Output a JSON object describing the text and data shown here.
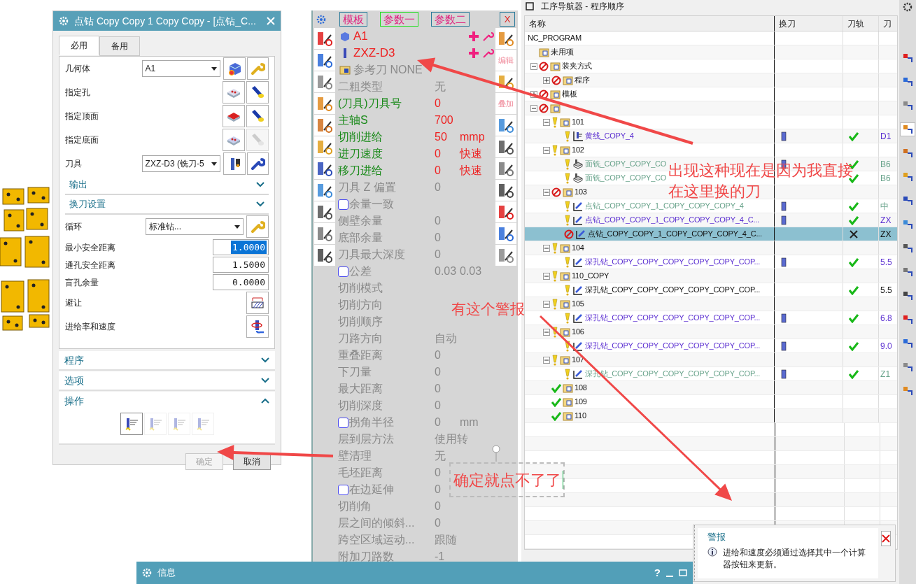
{
  "dialog": {
    "title": "点钻 Copy Copy 1 Copy Copy - [点钻_C...",
    "tabs": [
      {
        "label": "必用",
        "selected": true
      },
      {
        "label": "备用",
        "selected": false
      }
    ],
    "rows": [
      {
        "kind": "select",
        "label": "几何体",
        "value": "A1"
      },
      {
        "kind": "pick",
        "label": "指定孔",
        "disabled": false
      },
      {
        "kind": "pick",
        "label": "指定顶面",
        "disabled": false
      },
      {
        "kind": "pick",
        "label": "指定底面",
        "disabled": true
      },
      {
        "kind": "select",
        "label": "刀具",
        "value": "ZXZ-D3 (铣刀-5"
      },
      {
        "kind": "section",
        "label": "输出",
        "expanded": false
      },
      {
        "kind": "section",
        "label": "换刀设置",
        "expanded": false
      },
      {
        "kind": "select",
        "label": "循环",
        "value": "标准钻..."
      },
      {
        "kind": "number",
        "label": "最小安全距离",
        "value": "1.0000",
        "focused": true
      },
      {
        "kind": "number",
        "label": "通孔安全距离",
        "value": "1.5000",
        "focused": false
      },
      {
        "kind": "number",
        "label": "盲孔余量",
        "value": "0.0000",
        "focused": false
      },
      {
        "kind": "pick",
        "label": "避让"
      },
      {
        "kind": "pick",
        "label": "进给率和速度"
      }
    ],
    "groups": [
      {
        "label": "程序",
        "expanded": false
      },
      {
        "label": "选项",
        "expanded": false
      },
      {
        "label": "操作",
        "expanded": true
      }
    ],
    "actions": [
      {
        "disabled": false
      },
      {
        "disabled": true
      },
      {
        "disabled": true
      },
      {
        "disabled": true
      }
    ],
    "buttons": [
      {
        "label": "确定",
        "disabled": true
      },
      {
        "label": "取消",
        "disabled": false
      }
    ]
  },
  "param_panel": {
    "tabs": [
      {
        "label": "模板",
        "selected": false
      },
      {
        "label": "参数一",
        "selected": true
      },
      {
        "label": "参数二",
        "selected": false
      }
    ],
    "close": "X",
    "objects": [
      {
        "kind": "geometry",
        "label": "A1"
      },
      {
        "kind": "tool",
        "label": "ZXZ-D3"
      },
      {
        "kind": "reference",
        "label": "参考刀 NONE"
      }
    ],
    "right_tools": [
      {
        "kind": "icon"
      },
      {
        "kind": "text",
        "label": "编辑"
      },
      {
        "kind": "icon"
      },
      {
        "kind": "text",
        "label": "叠加"
      },
      {
        "kind": "icon"
      },
      {
        "kind": "icon"
      },
      {
        "kind": "icon"
      },
      {
        "kind": "icon"
      },
      {
        "kind": "icon"
      },
      {
        "kind": "icon"
      },
      {
        "kind": "icon"
      }
    ],
    "params": [
      {
        "kind": "field",
        "label": "二粗类型",
        "value": "无",
        "active": false
      },
      {
        "kind": "field",
        "label": "(刀具)刀具号",
        "value": "0",
        "active": true
      },
      {
        "kind": "field",
        "label": "主轴S",
        "value": "700",
        "active": true
      },
      {
        "kind": "field",
        "label": "切削进给",
        "value": "50",
        "unit": "mmp",
        "active": true
      },
      {
        "kind": "field",
        "label": "进刀速度",
        "value": "0",
        "unit": "快速",
        "active": true
      },
      {
        "kind": "field",
        "label": "移刀进给",
        "value": "0",
        "unit": "快速",
        "active": true
      },
      {
        "kind": "field",
        "label": "刀具 Z 偏置",
        "value": "0",
        "active": false
      },
      {
        "kind": "checkbox",
        "label": "余量一致",
        "checked": false,
        "active": false
      },
      {
        "kind": "field",
        "label": "侧壁余量",
        "value": "0",
        "active": false
      },
      {
        "kind": "field",
        "label": "底部余量",
        "value": "0",
        "active": false
      },
      {
        "kind": "field",
        "label": "刀具最大深度",
        "value": "0",
        "active": false
      },
      {
        "kind": "checkbox",
        "label": "公差",
        "checked": false,
        "value": "0.03",
        "value_2": "0.03",
        "active": false
      },
      {
        "kind": "field",
        "label": "切削模式",
        "active": false
      },
      {
        "kind": "field",
        "label": "切削方向",
        "active": false
      },
      {
        "kind": "field",
        "label": "切削顺序",
        "active": false
      },
      {
        "kind": "field",
        "label": "刀路方向",
        "value": "自动",
        "active": false
      },
      {
        "kind": "field",
        "label": "重叠距离",
        "value": "0",
        "active": false
      },
      {
        "kind": "field",
        "label": "下刀量",
        "value": "0",
        "active": false
      },
      {
        "kind": "field",
        "label": "最大距离",
        "value": "0",
        "active": false
      },
      {
        "kind": "field",
        "label": "切削深度",
        "value": "0",
        "active": false
      },
      {
        "kind": "checkbox",
        "label": "拐角半径",
        "checked": false,
        "value": "0",
        "unit": "mm",
        "active": false
      },
      {
        "kind": "field",
        "label": "层到层方法",
        "value": "使用转",
        "active": false
      },
      {
        "kind": "field",
        "label": "壁清理",
        "value": "无",
        "active": false
      },
      {
        "kind": "field",
        "label": "毛坯距离",
        "value": "0",
        "active": false
      },
      {
        "kind": "checkbox",
        "label": "在边延伸",
        "checked": false,
        "value": "0",
        "active": false
      },
      {
        "kind": "field",
        "label": "切削角",
        "value": "0",
        "active": false
      },
      {
        "kind": "field",
        "label": "层之间的倾斜...",
        "value": "0",
        "active": false
      },
      {
        "kind": "field",
        "label": "跨空区域运动...",
        "value": "跟随",
        "active": false
      },
      {
        "kind": "field",
        "label": "附加刀路数",
        "value": "-1",
        "active": false
      }
    ]
  },
  "navigator": {
    "title": "工序导航器 - 程序顺序",
    "columns": [
      "名称",
      "换刀",
      "刀轨",
      "刀"
    ],
    "tree": [
      {
        "name": "NC_PROGRAM",
        "selected": false,
        "children": [
          {
            "name": "未用项",
            "kind": "folder",
            "selected": false
          },
          {
            "name": "装夹方式",
            "kind": "folder",
            "status": {
              "kind": "blocked"
            },
            "expanded": true,
            "selected": false,
            "children": [
              {
                "name": "程序",
                "kind": "folder",
                "status": {
                  "kind": "blocked"
                },
                "expanded": false,
                "selected": false
              }
            ]
          },
          {
            "name": "模板",
            "kind": "folder",
            "status": {
              "kind": "blocked"
            },
            "expanded": false,
            "selected": false
          },
          {
            "kind": "folder",
            "status": {
              "kind": "blocked"
            },
            "expanded": true,
            "selected": false,
            "children": [
              {
                "name": "101",
                "kind": "folder",
                "status": {
                  "kind": "warning"
                },
                "expanded": true,
                "selected": false,
                "children": [
                  {
                    "name": "黄线_COPY_4",
                    "kind": "planar",
                    "status": {
                      "kind": "warning"
                    },
                    "color": "#5b2fd1",
                    "tool_change": true,
                    "toolpath": {
                      "kind": "ok"
                    },
                    "column_4": "D1",
                    "selected": false
                  }
                ]
              },
              {
                "name": "102",
                "kind": "folder",
                "status": {
                  "kind": "warning"
                },
                "expanded": true,
                "selected": false,
                "children": [
                  {
                    "name": "面铣_COPY_COPY_CO",
                    "kind": "facemill",
                    "status": {
                      "kind": "warning"
                    },
                    "color": "#6aa48c",
                    "tool_change": true,
                    "toolpath": {
                      "kind": "ok"
                    },
                    "column_4": "B6",
                    "selected": false
                  },
                  {
                    "name": "面铣_COPY_COPY_CO",
                    "kind": "facemill",
                    "status": {
                      "kind": "warning"
                    },
                    "color": "#6aa48c",
                    "tool_change": false,
                    "toolpath": {
                      "kind": "ok"
                    },
                    "column_4": "B6",
                    "selected": false
                  }
                ]
              },
              {
                "name": "103",
                "kind": "folder",
                "status": {
                  "kind": "blocked"
                },
                "expanded": true,
                "selected": false,
                "children": [
                  {
                    "name": "点钻_COPY_COPY_1_COPY_COPY_COPY_4",
                    "kind": "drill",
                    "status": {
                      "kind": "warning"
                    },
                    "color": "#6aa48c",
                    "tool_change": true,
                    "toolpath": {
                      "kind": "ok"
                    },
                    "column_4": "中",
                    "selected": false
                  },
                  {
                    "name": "点钻_COPY_COPY_1_COPY_COPY_COPY_4_C...",
                    "kind": "drill",
                    "status": {
                      "kind": "warning"
                    },
                    "color": "#5b2fd1",
                    "tool_change": true,
                    "toolpath": {
                      "kind": "ok"
                    },
                    "column_4": "ZX",
                    "selected": false
                  },
                  {
                    "name": "点钻_COPY_COPY_1_COPY_COPY_COPY_4_C...",
                    "kind": "drill",
                    "status": {
                      "kind": "blocked"
                    },
                    "tool_change": false,
                    "toolpath": {
                      "kind": "failed"
                    },
                    "column_4": "ZX",
                    "selected": true
                  }
                ]
              },
              {
                "name": "104",
                "kind": "folder",
                "status": {
                  "kind": "warning"
                },
                "expanded": true,
                "selected": false,
                "children": [
                  {
                    "name": "深孔钻_COPY_COPY_COPY_COPY_COPY_COP...",
                    "kind": "drill",
                    "status": {
                      "kind": "warning"
                    },
                    "color": "#5b2fd1",
                    "tool_change": true,
                    "toolpath": {
                      "kind": "ok"
                    },
                    "column_4": "5.5",
                    "selected": false
                  }
                ]
              },
              {
                "name": "110_COPY",
                "kind": "folder",
                "status": {
                  "kind": "warning"
                },
                "expanded": true,
                "selected": false,
                "children": [
                  {
                    "name": "深孔钻_COPY_COPY_COPY_COPY_COPY_COP...",
                    "kind": "drill",
                    "status": {
                      "kind": "warning"
                    },
                    "tool_change": false,
                    "toolpath": {
                      "kind": "ok"
                    },
                    "column_4": "5.5",
                    "selected": false
                  }
                ]
              },
              {
                "name": "105",
                "kind": "folder",
                "status": {
                  "kind": "warning"
                },
                "expanded": true,
                "selected": false,
                "children": [
                  {
                    "name": "深孔钻_COPY_COPY_COPY_COPY_COPY_COP...",
                    "kind": "drill",
                    "status": {
                      "kind": "warning"
                    },
                    "color": "#5b2fd1",
                    "tool_change": true,
                    "toolpath": {
                      "kind": "ok"
                    },
                    "column_4": "6.8",
                    "selected": false
                  }
                ]
              },
              {
                "name": "106",
                "kind": "folder",
                "status": {
                  "kind": "warning"
                },
                "expanded": true,
                "selected": false,
                "children": [
                  {
                    "name": "深孔钻_COPY_COPY_COPY_COPY_COPY_COP...",
                    "kind": "drill",
                    "status": {
                      "kind": "warning"
                    },
                    "color": "#5b2fd1",
                    "tool_change": true,
                    "toolpath": {
                      "kind": "ok"
                    },
                    "column_4": "9.0",
                    "selected": false
                  }
                ]
              },
              {
                "name": "107",
                "kind": "folder",
                "status": {
                  "kind": "warning"
                },
                "expanded": true,
                "selected": false,
                "children": [
                  {
                    "name": "深孔钻_COPY_COPY_COPY_COPY_COPY_COP...",
                    "kind": "drill",
                    "status": {
                      "kind": "warning"
                    },
                    "color": "#6aa48c",
                    "tool_change": true,
                    "toolpath": {
                      "kind": "ok"
                    },
                    "column_4": "Z1",
                    "selected": false
                  }
                ]
              },
              {
                "name": "108",
                "kind": "folder",
                "status": {
                  "kind": "ok"
                },
                "selected": false
              },
              {
                "name": "109",
                "kind": "folder",
                "status": {
                  "kind": "ok"
                },
                "selected": false
              },
              {
                "name": "110",
                "kind": "folder",
                "status": {
                  "kind": "ok"
                },
                "selected": false
              }
            ]
          }
        ]
      }
    ]
  },
  "side_toolbar": [
    {
      "selected": false
    },
    {
      "selected": false
    },
    {
      "selected": false
    },
    {
      "selected": true
    },
    {
      "selected": false
    },
    {
      "selected": false
    },
    {
      "selected": false
    },
    {
      "selected": false
    },
    {
      "selected": false
    },
    {
      "selected": false
    },
    {
      "selected": false
    },
    {
      "selected": false
    },
    {
      "selected": false
    },
    {
      "selected": false
    },
    {
      "selected": false
    }
  ],
  "info_bar": {
    "title": "信息",
    "help": "?"
  },
  "alert": {
    "title": "警报",
    "message": "进给和速度必须通过选择其中一个计算器按钮来更新。"
  },
  "annotations": [
    {
      "kind": "note",
      "text": "出现这种现在是因为我直接"
    },
    {
      "kind": "note",
      "text": "在这里换的刀"
    },
    {
      "kind": "note",
      "text": "有这个警报"
    },
    {
      "kind": "textbox",
      "text": "确定就点不了了"
    }
  ]
}
